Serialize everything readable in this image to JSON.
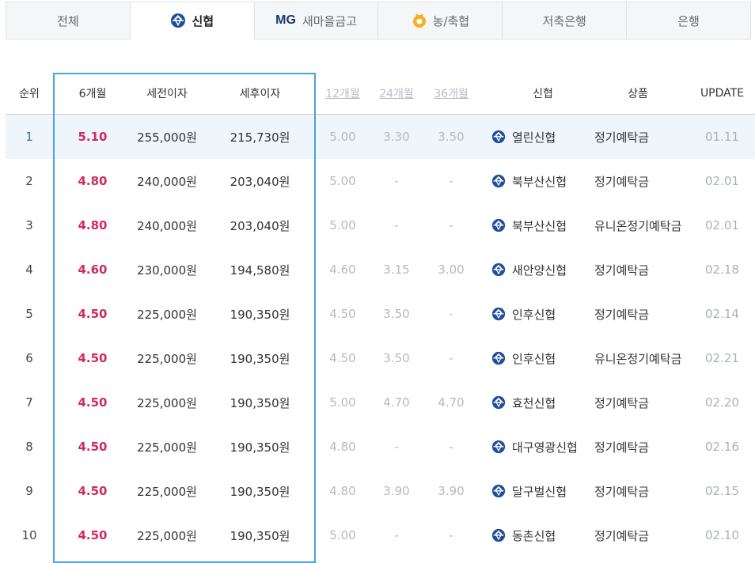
{
  "tabs": [
    {
      "label": "전체",
      "icon": "",
      "prefix": ""
    },
    {
      "label": "신협",
      "icon": "shinhyup-logo-icon",
      "prefix": "",
      "active": true
    },
    {
      "label": "새마을금고",
      "icon": "",
      "prefix": "MG"
    },
    {
      "label": "농/축협",
      "icon": "nonghyup-logo-icon",
      "prefix": ""
    },
    {
      "label": "저축은행",
      "icon": "",
      "prefix": ""
    },
    {
      "label": "은행",
      "icon": "",
      "prefix": ""
    }
  ],
  "header": {
    "rank": "순위",
    "m6": "6개월",
    "pre_tax": "세전이자",
    "post_tax": "세후이자",
    "m12": "12개월",
    "m24": "24개월",
    "m36": "36개월",
    "bank": "신협",
    "product": "상품",
    "update": "UPDATE"
  },
  "rows": [
    {
      "rank": "1",
      "m6": "5.10",
      "pre_tax": "255,000원",
      "post_tax": "215,730원",
      "m12": "5.00",
      "m24": "3.30",
      "m36": "3.50",
      "bank": "열린신협",
      "product": "정기예탁금",
      "update": "01.11"
    },
    {
      "rank": "2",
      "m6": "4.80",
      "pre_tax": "240,000원",
      "post_tax": "203,040원",
      "m12": "5.00",
      "m24": "-",
      "m36": "-",
      "bank": "북부산신협",
      "product": "정기예탁금",
      "update": "02.01"
    },
    {
      "rank": "3",
      "m6": "4.80",
      "pre_tax": "240,000원",
      "post_tax": "203,040원",
      "m12": "5.00",
      "m24": "-",
      "m36": "-",
      "bank": "북부산신협",
      "product": "유니온정기예탁금",
      "update": "02.01"
    },
    {
      "rank": "4",
      "m6": "4.60",
      "pre_tax": "230,000원",
      "post_tax": "194,580원",
      "m12": "4.60",
      "m24": "3.15",
      "m36": "3.00",
      "bank": "새안양신협",
      "product": "정기예탁금",
      "update": "02.18"
    },
    {
      "rank": "5",
      "m6": "4.50",
      "pre_tax": "225,000원",
      "post_tax": "190,350원",
      "m12": "4.50",
      "m24": "3.50",
      "m36": "-",
      "bank": "인후신협",
      "product": "정기예탁금",
      "update": "02.14"
    },
    {
      "rank": "6",
      "m6": "4.50",
      "pre_tax": "225,000원",
      "post_tax": "190,350원",
      "m12": "4.50",
      "m24": "3.50",
      "m36": "-",
      "bank": "인후신협",
      "product": "유니온정기예탁금",
      "update": "02.21"
    },
    {
      "rank": "7",
      "m6": "4.50",
      "pre_tax": "225,000원",
      "post_tax": "190,350원",
      "m12": "5.00",
      "m24": "4.70",
      "m36": "4.70",
      "bank": "효천신협",
      "product": "정기예탁금",
      "update": "02.20"
    },
    {
      "rank": "8",
      "m6": "4.50",
      "pre_tax": "225,000원",
      "post_tax": "190,350원",
      "m12": "4.80",
      "m24": "-",
      "m36": "-",
      "bank": "대구영광신협",
      "product": "정기예탁금",
      "update": "02.16"
    },
    {
      "rank": "9",
      "m6": "4.50",
      "pre_tax": "225,000원",
      "post_tax": "190,350원",
      "m12": "4.80",
      "m24": "3.90",
      "m36": "3.90",
      "bank": "달구벌신협",
      "product": "정기예탁금",
      "update": "02.15"
    },
    {
      "rank": "10",
      "m6": "4.50",
      "pre_tax": "225,000원",
      "post_tax": "190,350원",
      "m12": "5.00",
      "m24": "-",
      "m36": "-",
      "bank": "동촌신협",
      "product": "정기예탁금",
      "update": "02.10"
    }
  ],
  "colors": {
    "accent_rate": "#d22b5e",
    "frame": "#4aa3df",
    "highlight_row": "#eef5fb",
    "logo_blue": "#1f4e9c"
  }
}
